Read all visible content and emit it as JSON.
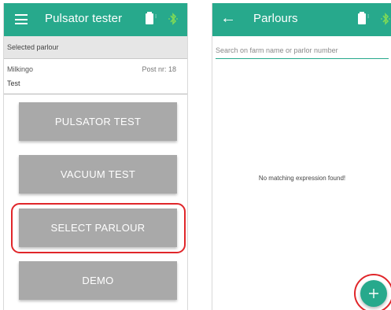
{
  "left_screen": {
    "appbar": {
      "title": "Pulsator tester",
      "menu_icon": "hamburger-menu-icon",
      "battery_icon": "battery-icon",
      "bluetooth_icon": "bluetooth-icon"
    },
    "section_label": "Selected parlour",
    "parlour": {
      "farm": "Milkingo",
      "post": "Post nr: 18",
      "name": "Test"
    },
    "buttons": {
      "pulsator_test": "PULSATOR TEST",
      "vacuum_test": "VACUUM TEST",
      "select_parlour": "SELECT PARLOUR",
      "demo": "DEMO"
    }
  },
  "right_screen": {
    "appbar": {
      "title": "Parlours",
      "back_icon": "back-arrow-icon",
      "battery_icon": "battery-icon",
      "bluetooth_icon": "bluetooth-icon"
    },
    "search": {
      "value": "",
      "placeholder": "Search on farm name or parlor number"
    },
    "empty_message": "No matching expression found!",
    "fab_icon": "plus-icon"
  },
  "colors": {
    "primary": "#27a98c",
    "button_gray": "#a9a9a9",
    "highlight_red": "#e0262a",
    "bluetooth_green": "#7ed957"
  }
}
